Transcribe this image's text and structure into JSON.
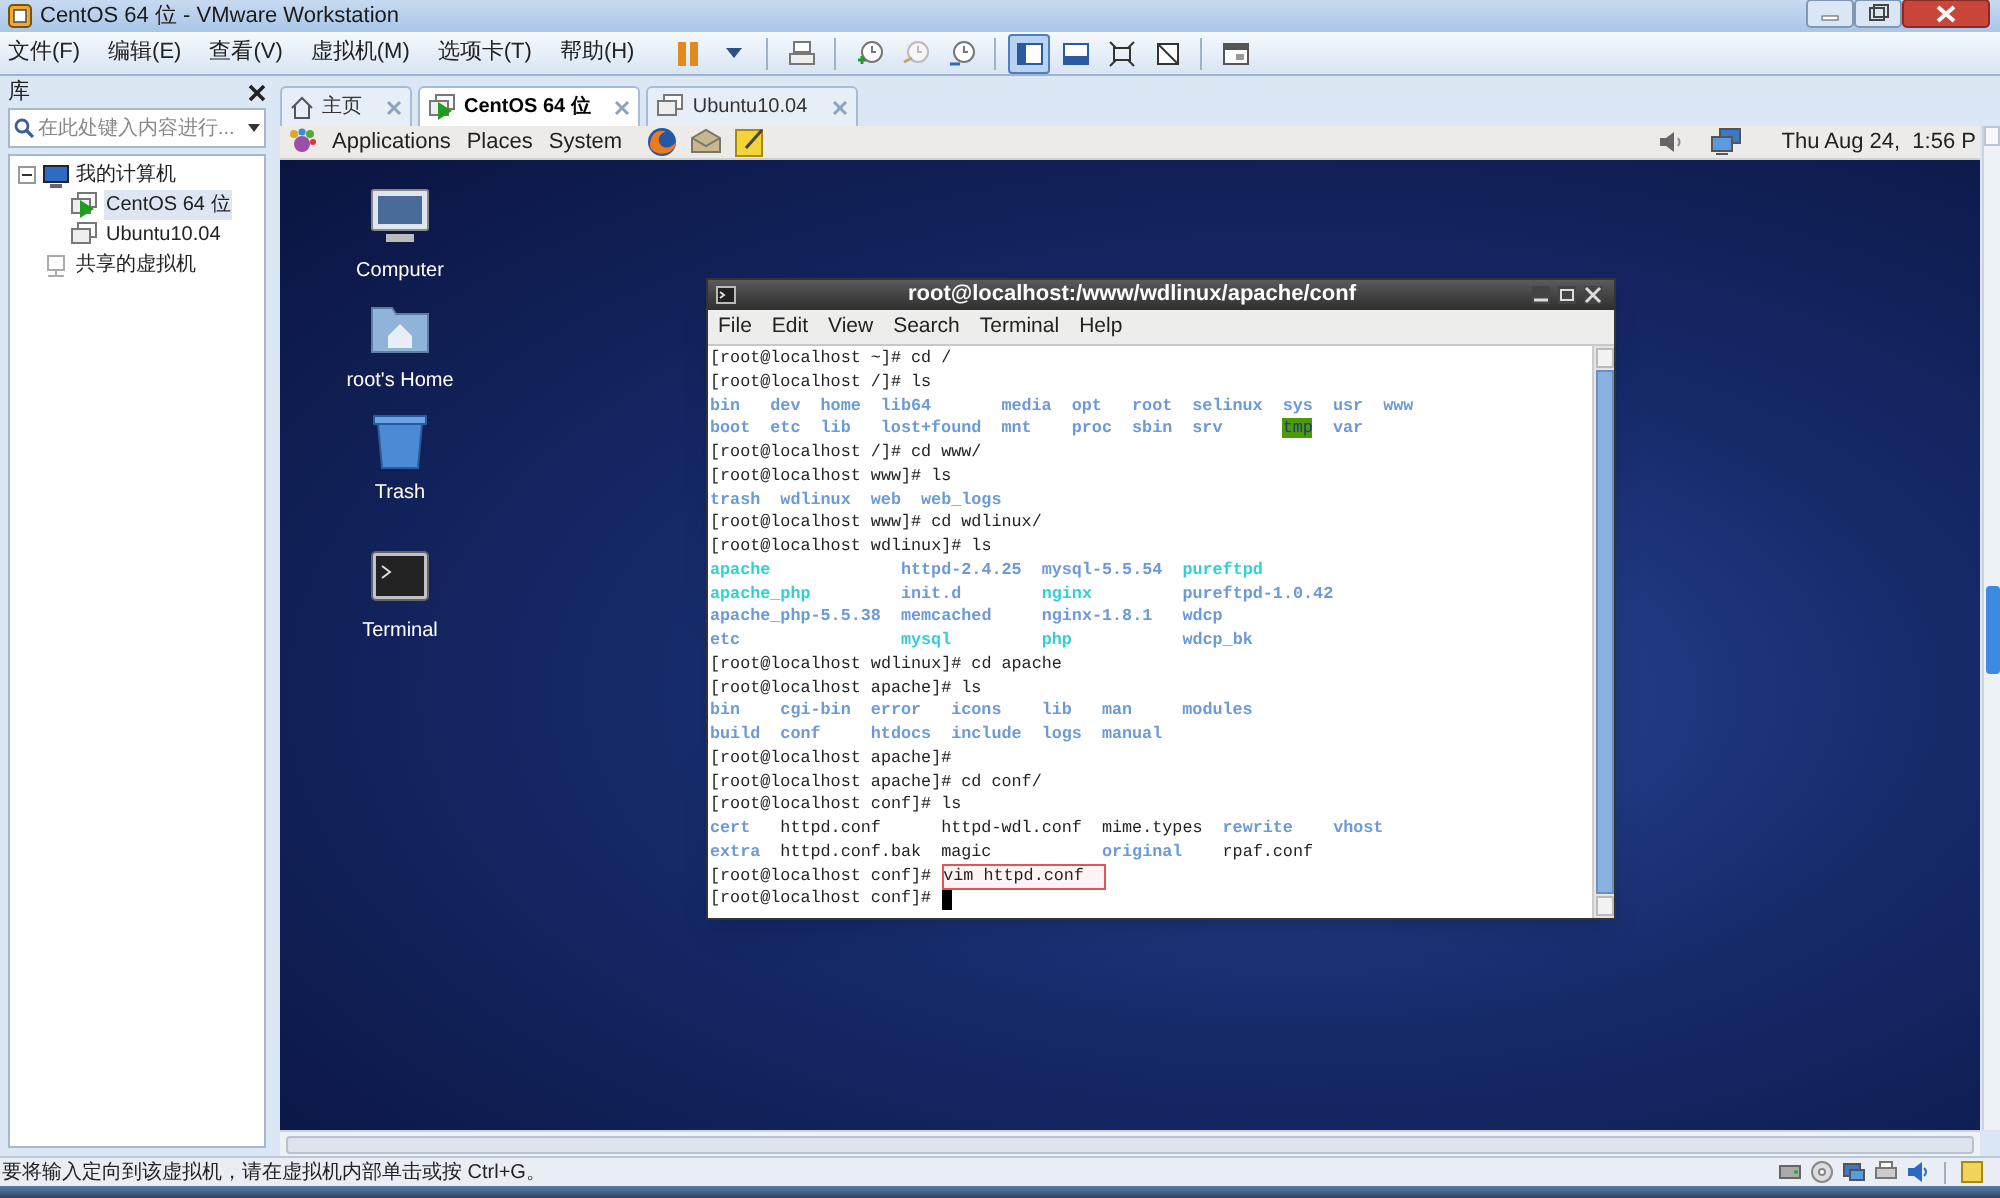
{
  "window": {
    "title": "CentOS 64 位 - VMware Workstation"
  },
  "menu": [
    "文件(F)",
    "编辑(E)",
    "查看(V)",
    "虚拟机(M)",
    "选项卡(T)",
    "帮助(H)"
  ],
  "toolbar": [
    [
      {
        "kind": "pause",
        "selected": false
      },
      {
        "kind": "caret",
        "selected": false
      }
    ],
    [
      {
        "kind": "send-keys",
        "selected": false
      }
    ],
    [
      {
        "kind": "snapshot",
        "selected": false
      },
      {
        "kind": "revert",
        "selected": false
      },
      {
        "kind": "manager",
        "selected": false
      }
    ],
    [
      {
        "kind": "sidebar",
        "selected": true
      },
      {
        "kind": "thumbs",
        "selected": false
      },
      {
        "kind": "fullscreen",
        "selected": false
      },
      {
        "kind": "unity",
        "selected": false
      }
    ],
    [
      {
        "kind": "console",
        "selected": false
      }
    ]
  ],
  "library": {
    "title": "库",
    "search": {
      "placeholder": "在此处键入内容进行..."
    },
    "tree": [
      {
        "label": "我的计算机",
        "kind": "computer",
        "children": [
          {
            "label": "CentOS 64 位",
            "selected": true,
            "running": true
          },
          {
            "label": "Ubuntu10.04",
            "selected": false,
            "running": false
          }
        ]
      },
      {
        "label": "共享的虚拟机",
        "kind": "shared"
      }
    ]
  },
  "tabs": [
    {
      "label": "主页",
      "kind": "home",
      "selected": false
    },
    {
      "label": "CentOS 64 位",
      "kind": "vm",
      "selected": true,
      "running": true
    },
    {
      "label": "Ubuntu10.04",
      "kind": "vm",
      "selected": false,
      "running": false
    }
  ],
  "guest_panel": {
    "menus": [
      "Applications",
      "Places",
      "System"
    ],
    "launchers": [
      {
        "kind": "browser"
      },
      {
        "kind": "mail"
      },
      {
        "kind": "notes"
      }
    ],
    "clock": "Thu Aug 24,  1:56 P"
  },
  "desktop_icons": [
    {
      "label": "Computer",
      "kind": "computer"
    },
    {
      "label": "root's Home",
      "kind": "home"
    },
    {
      "label": "Trash",
      "kind": "trash"
    },
    {
      "label": "Terminal",
      "kind": "terminal"
    }
  ],
  "terminal": {
    "title": "root@localhost:/www/wdlinux/apache/conf",
    "menus": [
      "File",
      "Edit",
      "View",
      "Search",
      "Terminal",
      "Help"
    ],
    "lines": [
      {
        "kind": "prompt",
        "text": "[root@localhost ~]# cd /"
      },
      {
        "kind": "prompt",
        "text": "[root@localhost /]# ls"
      },
      {
        "kind": "listing",
        "columns": [
          [
            {
              "name": "bin",
              "kind": "dir"
            },
            {
              "name": "boot",
              "kind": "dir"
            }
          ],
          [
            {
              "name": "dev",
              "kind": "dir"
            },
            {
              "name": "etc",
              "kind": "dir"
            }
          ],
          [
            {
              "name": "home",
              "kind": "dir"
            },
            {
              "name": "lib",
              "kind": "dir"
            }
          ],
          [
            {
              "name": "lib64",
              "kind": "dir"
            },
            {
              "name": "lost+found",
              "kind": "dir"
            }
          ],
          [
            {
              "name": "media",
              "kind": "dir"
            },
            {
              "name": "mnt",
              "kind": "dir"
            }
          ],
          [
            {
              "name": "opt",
              "kind": "dir"
            },
            {
              "name": "proc",
              "kind": "dir"
            }
          ],
          [
            {
              "name": "root",
              "kind": "dir"
            },
            {
              "name": "sbin",
              "kind": "dir"
            }
          ],
          [
            {
              "name": "selinux",
              "kind": "dir"
            },
            {
              "name": "srv",
              "kind": "dir"
            }
          ],
          [
            {
              "name": "sys",
              "kind": "dir"
            },
            {
              "name": "tmp",
              "kind": "sticky"
            }
          ],
          [
            {
              "name": "usr",
              "kind": "dir"
            },
            {
              "name": "var",
              "kind": "dir"
            }
          ],
          [
            {
              "name": "www",
              "kind": "dir"
            }
          ]
        ]
      },
      {
        "kind": "prompt",
        "text": "[root@localhost /]# cd www/"
      },
      {
        "kind": "prompt",
        "text": "[root@localhost www]# ls"
      },
      {
        "kind": "listing",
        "columns": [
          [
            {
              "name": "trash",
              "kind": "dir"
            }
          ],
          [
            {
              "name": "wdlinux",
              "kind": "dir"
            }
          ],
          [
            {
              "name": "web",
              "kind": "dir"
            }
          ],
          [
            {
              "name": "web_logs",
              "kind": "dir"
            }
          ]
        ]
      },
      {
        "kind": "prompt",
        "text": "[root@localhost www]# cd wdlinux/"
      },
      {
        "kind": "prompt",
        "text": "[root@localhost wdlinux]# ls"
      },
      {
        "kind": "listing",
        "columns": [
          [
            {
              "name": "apache",
              "kind": "link"
            },
            {
              "name": "apache_php",
              "kind": "link"
            },
            {
              "name": "apache_php-5.5.38",
              "kind": "dir"
            },
            {
              "name": "etc",
              "kind": "dir"
            }
          ],
          [
            {
              "name": "httpd-2.4.25",
              "kind": "dir"
            },
            {
              "name": "init.d",
              "kind": "dir"
            },
            {
              "name": "memcached",
              "kind": "dir"
            },
            {
              "name": "mysql",
              "kind": "link"
            }
          ],
          [
            {
              "name": "mysql-5.5.54",
              "kind": "dir"
            },
            {
              "name": "nginx",
              "kind": "link"
            },
            {
              "name": "nginx-1.8.1",
              "kind": "dir"
            },
            {
              "name": "php",
              "kind": "link"
            }
          ],
          [
            {
              "name": "pureftpd",
              "kind": "link"
            },
            {
              "name": "pureftpd-1.0.42",
              "kind": "dir"
            },
            {
              "name": "wdcp",
              "kind": "dir"
            },
            {
              "name": "wdcp_bk",
              "kind": "dir"
            }
          ]
        ]
      },
      {
        "kind": "prompt",
        "text": "[root@localhost wdlinux]# cd apache"
      },
      {
        "kind": "prompt",
        "text": "[root@localhost apache]# ls"
      },
      {
        "kind": "listing",
        "columns": [
          [
            {
              "name": "bin",
              "kind": "dir"
            },
            {
              "name": "build",
              "kind": "dir"
            }
          ],
          [
            {
              "name": "cgi-bin",
              "kind": "dir"
            },
            {
              "name": "conf",
              "kind": "dir"
            }
          ],
          [
            {
              "name": "error",
              "kind": "dir"
            },
            {
              "name": "htdocs",
              "kind": "dir"
            }
          ],
          [
            {
              "name": "icons",
              "kind": "dir"
            },
            {
              "name": "include",
              "kind": "dir"
            }
          ],
          [
            {
              "name": "lib",
              "kind": "dir"
            },
            {
              "name": "logs",
              "kind": "dir"
            }
          ],
          [
            {
              "name": "man",
              "kind": "dir"
            },
            {
              "name": "manual",
              "kind": "dir"
            }
          ],
          [
            {
              "name": "modules",
              "kind": "dir"
            }
          ]
        ]
      },
      {
        "kind": "prompt",
        "text": "[root@localhost apache]#"
      },
      {
        "kind": "prompt",
        "text": "[root@localhost apache]# cd conf/"
      },
      {
        "kind": "prompt",
        "text": "[root@localhost conf]# ls"
      },
      {
        "kind": "listing",
        "columns": [
          [
            {
              "name": "cert",
              "kind": "dir"
            },
            {
              "name": "extra",
              "kind": "dir"
            }
          ],
          [
            {
              "name": "httpd.conf",
              "kind": "file"
            },
            {
              "name": "httpd.conf.bak",
              "kind": "file"
            }
          ],
          [
            {
              "name": "httpd-wdl.conf",
              "kind": "file"
            },
            {
              "name": "magic",
              "kind": "file"
            }
          ],
          [
            {
              "name": "mime.types",
              "kind": "file"
            },
            {
              "name": "original",
              "kind": "dir"
            }
          ],
          [
            {
              "name": "rewrite",
              "kind": "dir"
            },
            {
              "name": "rpaf.conf",
              "kind": "file"
            }
          ],
          [
            {
              "name": "vhost",
              "kind": "dir"
            }
          ]
        ]
      },
      {
        "kind": "prompt",
        "text": "[root@localhost conf]#",
        "command": "vim httpd.conf",
        "marked": true
      },
      {
        "kind": "prompt",
        "text": "[root@localhost conf]#",
        "cursor": true
      }
    ]
  },
  "status_bar": {
    "text": "要将输入定向到该虚拟机，请在虚拟机内部单击或按 Ctrl+G。",
    "devices": [
      {
        "kind": "disk"
      },
      {
        "kind": "cdrom"
      },
      {
        "kind": "network"
      },
      {
        "kind": "printer"
      },
      {
        "kind": "sound"
      },
      {
        "kind": "message"
      }
    ]
  }
}
